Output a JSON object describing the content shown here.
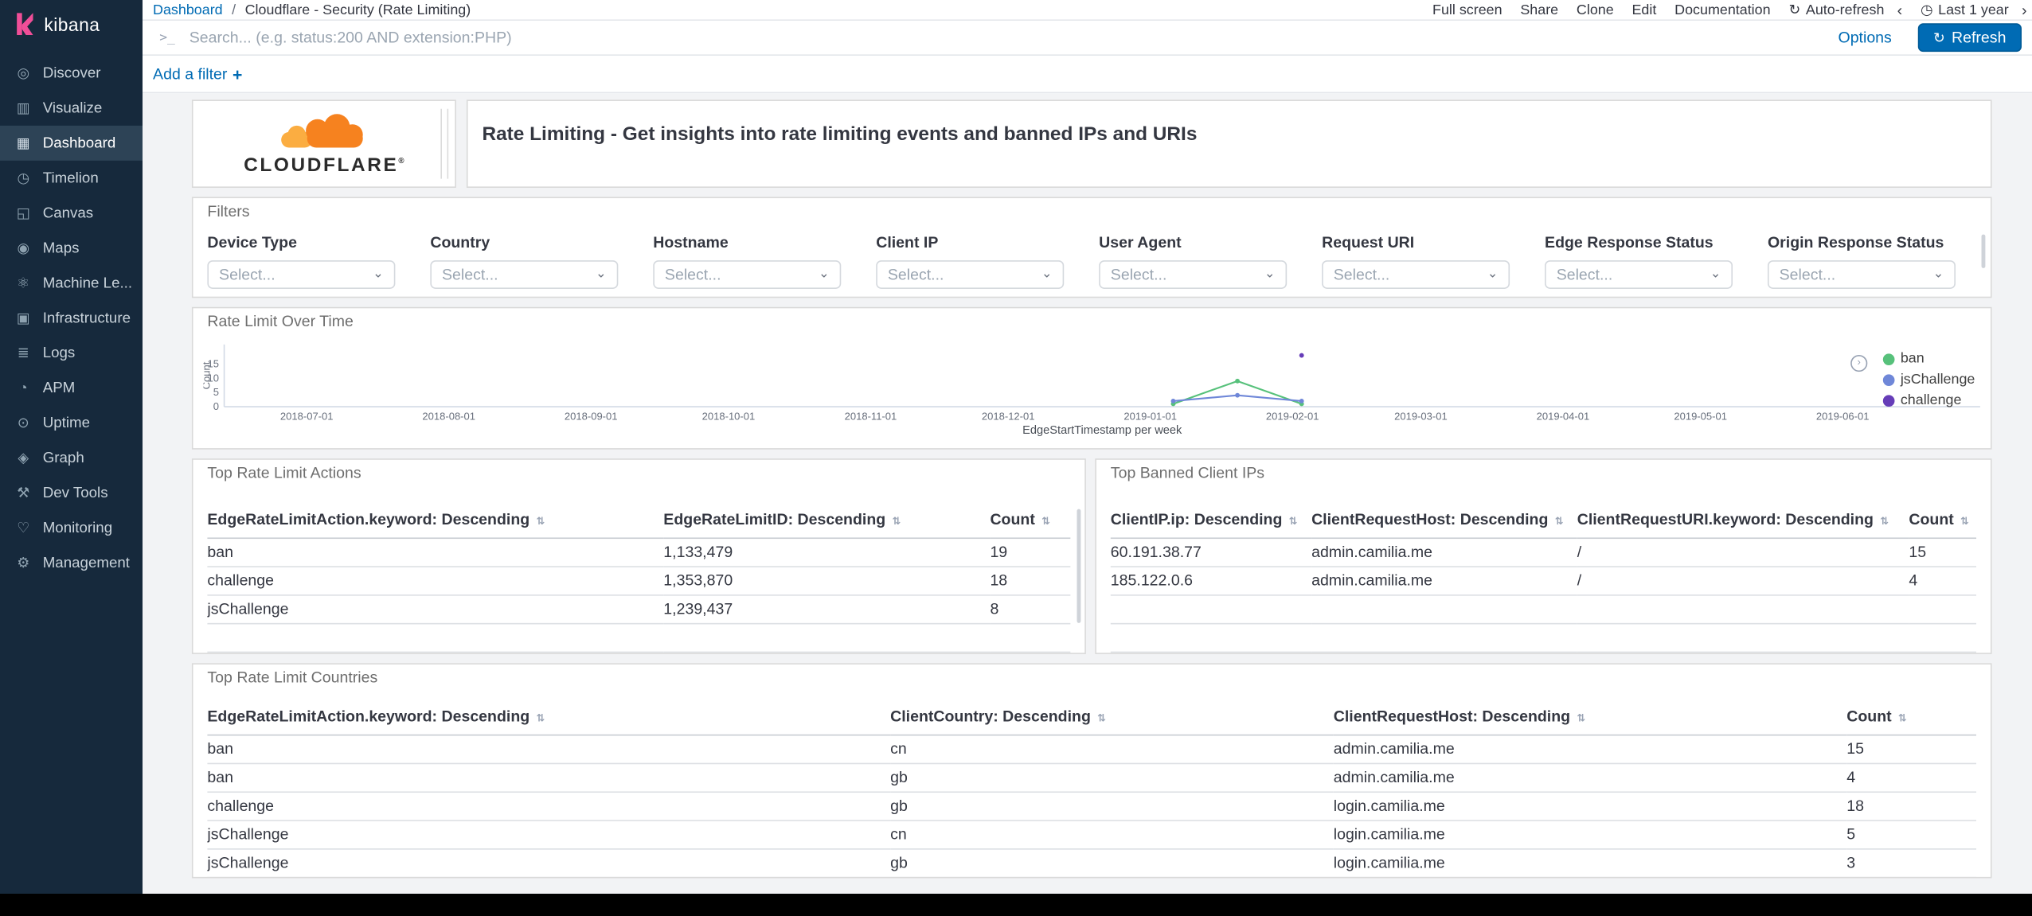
{
  "colors": {
    "accent_blue": "#006BB4",
    "sidebar_bg": "#16293C",
    "kibana_pink": "#F04E98",
    "cloudflare_orange": "#F6821F",
    "cloudflare_light_orange": "#FBAD41",
    "series_ban": "#57C17B",
    "series_jschallenge": "#6F87D8",
    "series_challenge": "#663DB8"
  },
  "sidebar": {
    "logo_text": "kibana",
    "items": [
      {
        "label": "Discover",
        "icon": "discover-icon",
        "glyph": "◎",
        "active": false
      },
      {
        "label": "Visualize",
        "icon": "visualize-icon",
        "glyph": "▥",
        "active": false
      },
      {
        "label": "Dashboard",
        "icon": "dashboard-icon",
        "glyph": "▦",
        "active": true
      },
      {
        "label": "Timelion",
        "icon": "timelion-icon",
        "glyph": "◷",
        "active": false
      },
      {
        "label": "Canvas",
        "icon": "canvas-icon",
        "glyph": "◱",
        "active": false
      },
      {
        "label": "Maps",
        "icon": "maps-icon",
        "glyph": "◉",
        "active": false
      },
      {
        "label": "Machine Le...",
        "icon": "machine-learning-icon",
        "glyph": "⚛",
        "active": false
      },
      {
        "label": "Infrastructure",
        "icon": "infrastructure-icon",
        "glyph": "▣",
        "active": false
      },
      {
        "label": "Logs",
        "icon": "logs-icon",
        "glyph": "≣",
        "active": false
      },
      {
        "label": "APM",
        "icon": "apm-icon",
        "glyph": "◔",
        "active": false
      },
      {
        "label": "Uptime",
        "icon": "uptime-icon",
        "glyph": "⊙",
        "active": false
      },
      {
        "label": "Graph",
        "icon": "graph-icon",
        "glyph": "◈",
        "active": false
      },
      {
        "label": "Dev Tools",
        "icon": "dev-tools-icon",
        "glyph": "⚒",
        "active": false
      },
      {
        "label": "Monitoring",
        "icon": "monitoring-icon",
        "glyph": "♡",
        "active": false
      },
      {
        "label": "Management",
        "icon": "management-icon",
        "glyph": "⚙",
        "active": false
      }
    ]
  },
  "header": {
    "breadcrumb_root": "Dashboard",
    "breadcrumb_separator": "/",
    "breadcrumb_current": "Cloudflare - Security (Rate Limiting)",
    "menu_items": [
      "Full screen",
      "Share",
      "Clone",
      "Edit",
      "Documentation"
    ],
    "auto_refresh_icon": "↻",
    "auto_refresh_label": "Auto-refresh",
    "prev_icon": "‹",
    "clock_icon": "◷",
    "time_range": "Last 1 year",
    "next_icon": "›"
  },
  "query_bar": {
    "prompt_icon": ">_",
    "placeholder": "Search... (e.g. status:200 AND extension:PHP)",
    "options_label": "Options",
    "refresh_icon": "↻",
    "refresh_label": "Refresh"
  },
  "filter_bar": {
    "add_filter_label": "Add a filter",
    "add_icon": "+"
  },
  "logo_panel": {
    "brand": "CLOUDFLARE",
    "registered": "®"
  },
  "markdown_panel": {
    "text": "Rate Limiting - Get insights into rate limiting events and banned IPs and URIs"
  },
  "filters_panel": {
    "title": "Filters",
    "select_placeholder": "Select...",
    "chevron_icon": "⌄",
    "fields": [
      "Device Type",
      "Country",
      "Hostname",
      "Client IP",
      "User Agent",
      "Request URI",
      "Edge Response Status",
      "Origin Response Status"
    ]
  },
  "chart_panel": {
    "title": "Rate Limit Over Time",
    "legend_toggle_icon": "›"
  },
  "chart_data": {
    "type": "line",
    "title": "Rate Limit Over Time",
    "xlabel": "EdgeStartTimestamp per week",
    "ylabel": "Count",
    "ylim": [
      0,
      18
    ],
    "yticks": [
      0,
      5,
      10,
      15
    ],
    "xticks": [
      "2018-07-01",
      "2018-08-01",
      "2018-09-01",
      "2018-10-01",
      "2018-11-01",
      "2018-12-01",
      "2019-01-01",
      "2019-02-01",
      "2019-03-01",
      "2019-04-01",
      "2019-05-01",
      "2019-06-01"
    ],
    "x_domain": [
      "2018-06-13",
      "2019-07-01"
    ],
    "grid": false,
    "legend_position": "right",
    "series": [
      {
        "name": "ban",
        "color": "#57C17B",
        "points": [
          {
            "x": "2019-01-06",
            "y": 1
          },
          {
            "x": "2019-01-20",
            "y": 9
          },
          {
            "x": "2019-02-03",
            "y": 1
          }
        ]
      },
      {
        "name": "jsChallenge",
        "color": "#6F87D8",
        "points": [
          {
            "x": "2019-01-06",
            "y": 2
          },
          {
            "x": "2019-01-20",
            "y": 4
          },
          {
            "x": "2019-02-03",
            "y": 2
          }
        ]
      },
      {
        "name": "challenge",
        "color": "#663DB8",
        "points": [
          {
            "x": "2019-02-03",
            "y": 18
          }
        ]
      }
    ]
  },
  "actions_table": {
    "title": "Top Rate Limit Actions",
    "columns": [
      "EdgeRateLimitAction.keyword: Descending",
      "EdgeRateLimitID: Descending",
      "Count"
    ],
    "rows": [
      [
        "ban",
        "1,133,479",
        "19"
      ],
      [
        "challenge",
        "1,353,870",
        "18"
      ],
      [
        "jsChallenge",
        "1,239,437",
        "8"
      ]
    ],
    "empty_rows": 1,
    "sort_icon": "⇅"
  },
  "banned_ips_table": {
    "title": "Top Banned Client IPs",
    "columns": [
      "ClientIP.ip: Descending",
      "ClientRequestHost: Descending",
      "ClientRequestURI.keyword: Descending",
      "Count"
    ],
    "rows": [
      [
        "60.191.38.77",
        "admin.camilia.me",
        "/",
        "15"
      ],
      [
        "185.122.0.6",
        "admin.camilia.me",
        "/",
        "4"
      ]
    ],
    "empty_rows": 2,
    "sort_icon": "⇅"
  },
  "countries_table": {
    "title": "Top Rate Limit Countries",
    "columns": [
      "EdgeRateLimitAction.keyword: Descending",
      "ClientCountry: Descending",
      "ClientRequestHost: Descending",
      "Count"
    ],
    "rows": [
      [
        "ban",
        "cn",
        "admin.camilia.me",
        "15"
      ],
      [
        "ban",
        "gb",
        "admin.camilia.me",
        "4"
      ],
      [
        "challenge",
        "gb",
        "login.camilia.me",
        "18"
      ],
      [
        "jsChallenge",
        "cn",
        "login.camilia.me",
        "5"
      ],
      [
        "jsChallenge",
        "gb",
        "login.camilia.me",
        "3"
      ]
    ],
    "empty_rows": 0,
    "sort_icon": "⇅"
  }
}
